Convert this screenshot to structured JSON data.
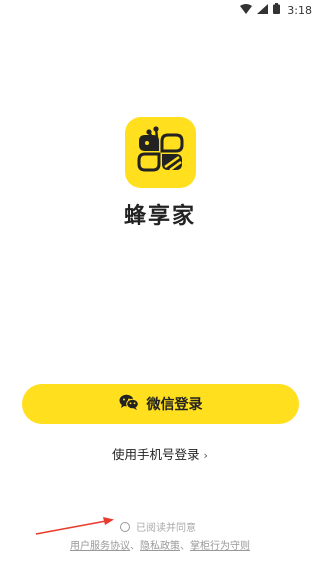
{
  "status_bar": {
    "time": "3:18"
  },
  "app": {
    "name": "蜂享家"
  },
  "login": {
    "wechat_label": "微信登录",
    "phone_label": "使用手机号登录",
    "phone_chevron": "›"
  },
  "agreement": {
    "checkbox_label": "已阅读并同意",
    "links": [
      "用户服务协议",
      "隐私政策",
      "掌柜行为守则"
    ],
    "separator": "、"
  },
  "colors": {
    "brand_yellow": "#ffdf1e",
    "annotation_arrow": "#e83a2f"
  }
}
